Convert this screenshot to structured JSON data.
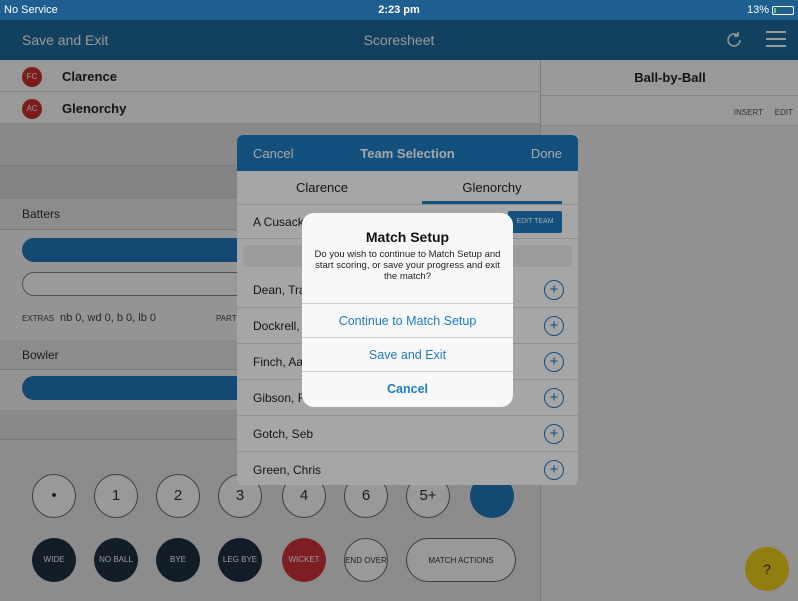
{
  "status_bar": {
    "carrier": "No Service",
    "time": "2:23 pm",
    "battery": "13%",
    "battery_level": 0.13
  },
  "navbar": {
    "left": "Save and Exit",
    "title": "Scoresheet"
  },
  "teams": [
    {
      "badge": "FC",
      "name": "Clarence"
    },
    {
      "badge": "AC",
      "name": "Glenorchy"
    }
  ],
  "sections": {
    "batters": "Batters",
    "bowler": "Bowler"
  },
  "extras": {
    "label": "EXTRAS",
    "value": "nb 0, wd 0, b 0, lb 0",
    "parts": "PARTS"
  },
  "keypad": {
    "runs": [
      "•",
      "1",
      "2",
      "3",
      "4",
      "6",
      "5+"
    ],
    "actions": [
      "WIDE",
      "NO BALL",
      "BYE",
      "LEG BYE",
      "WICKET",
      "END OVER"
    ],
    "match_actions": "MATCH ACTIONS"
  },
  "right_panel": {
    "title": "Ball-by-Ball",
    "insert": "INSERT",
    "edit": "EDIT"
  },
  "help": "?",
  "team_selection": {
    "cancel": "Cancel",
    "title": "Team Selection",
    "done": "Done",
    "tabs": [
      "Clarence",
      "Glenorchy"
    ],
    "captain": "A Cusack a",
    "edit_team": "EDIT TEAM",
    "players": [
      "Dean, Travi",
      "Dockrell, G",
      "Finch, Aaro",
      "Gibson, Ry",
      "Gotch, Seb",
      "Green, Chris"
    ]
  },
  "alert": {
    "title": "Match Setup",
    "message": "Do you wish to continue to Match Setup and start scoring, or save your progress and exit the match?",
    "buttons": [
      "Continue to Match Setup",
      "Save and Exit",
      "Cancel"
    ]
  }
}
